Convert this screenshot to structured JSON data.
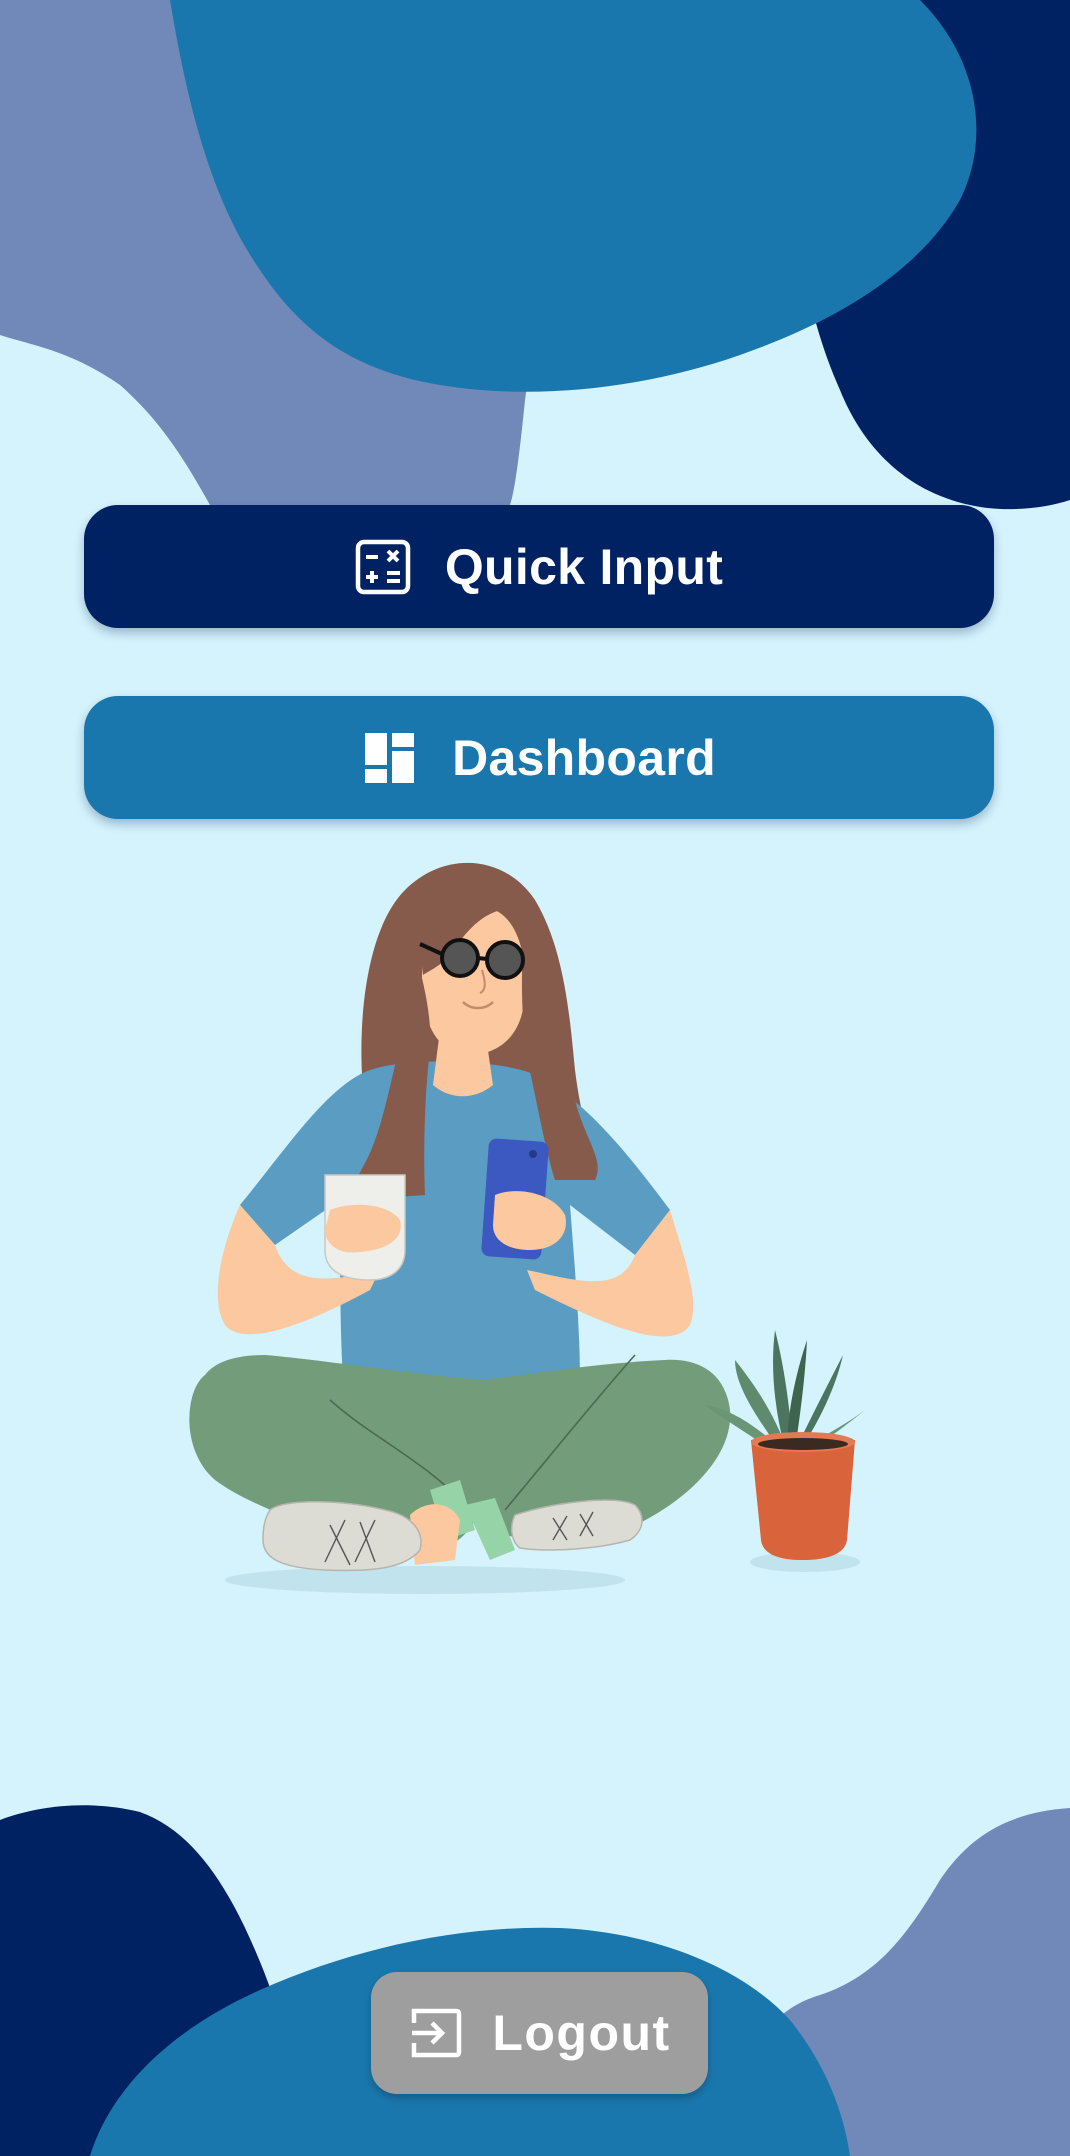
{
  "menu": {
    "quick_input": {
      "label": "Quick Input",
      "icon": "calculator-icon"
    },
    "dashboard": {
      "label": "Dashboard",
      "icon": "dashboard-icon"
    }
  },
  "logout": {
    "label": "Logout",
    "icon": "logout-icon"
  },
  "colors": {
    "background": "#d4f3fd",
    "navy": "#002263",
    "blue": "#1a77ad",
    "slate": "#7089b8",
    "logout": "#9e9e9e"
  }
}
